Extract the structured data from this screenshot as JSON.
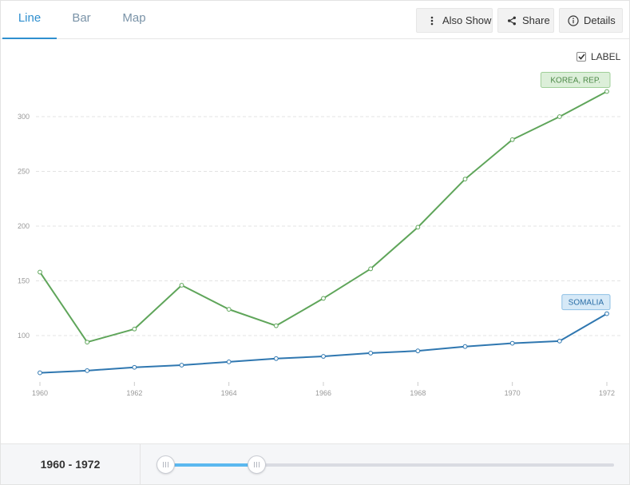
{
  "tabs": [
    {
      "label": "Line",
      "active": true
    },
    {
      "label": "Bar",
      "active": false
    },
    {
      "label": "Map",
      "active": false
    }
  ],
  "toolbar": {
    "also_show_label": "Also Show",
    "share_label": "Share",
    "details_label": "Details"
  },
  "label_toggle": {
    "label": "LABEL",
    "checked": true
  },
  "chart_data": {
    "type": "line",
    "x": [
      1960,
      1961,
      1962,
      1963,
      1964,
      1965,
      1966,
      1967,
      1968,
      1969,
      1970,
      1971,
      1972
    ],
    "x_tick_labels": [
      "1960",
      "1962",
      "1964",
      "1966",
      "1968",
      "1970",
      "1972"
    ],
    "y_tick_labels": [
      "100",
      "150",
      "200",
      "250",
      "300"
    ],
    "ylim": [
      45,
      345
    ],
    "grid": true,
    "series": [
      {
        "name": "KOREA, REP.",
        "color": "#5fa55a",
        "label_bg": "#dcefd9",
        "label_border": "#9fcf98",
        "label_text": "#4f8a49",
        "values": [
          158,
          94,
          106,
          146,
          124,
          109,
          134,
          161,
          199,
          243,
          279,
          300,
          323
        ]
      },
      {
        "name": "SOMALIA",
        "color": "#2f77b0",
        "label_bg": "#d6e9f7",
        "label_border": "#8ec0e5",
        "label_text": "#2b6ea7",
        "values": [
          66,
          68,
          71,
          73,
          76,
          79,
          81,
          84,
          86,
          90,
          93,
          95,
          120
        ]
      }
    ]
  },
  "footer": {
    "range_label": "1960 - 1972",
    "slider_start": 1960,
    "slider_end": 1972,
    "slider_fill_fraction": 0.2
  }
}
